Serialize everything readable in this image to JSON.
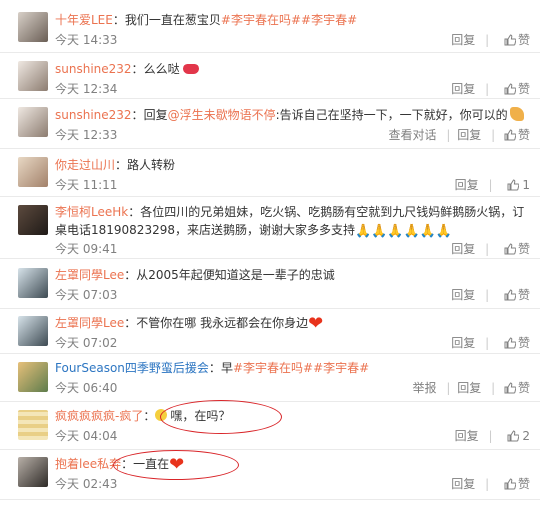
{
  "comments": [
    {
      "user": "十年爱LEE",
      "text": "我们一直在葱宝贝",
      "tags": [
        "#李宇春在吗#",
        "#李宇春#"
      ],
      "time": "今天 14:33",
      "reply_label": "回复",
      "like_label": "赞"
    },
    {
      "user": "sunshine232",
      "text": "么么哒",
      "emoji": "lips-emoji",
      "time": "今天 12:34",
      "reply_label": "回复",
      "like_label": "赞"
    },
    {
      "user": "sunshine232",
      "text_prefix": "回复",
      "mention": "@浮生未歇物语不停",
      "text": ":告诉自己在坚持一下，一下就好，你可以的",
      "emoji": "strong-arm-emoji",
      "time": "今天 12:33",
      "view_dialog_label": "查看对话",
      "reply_label": "回复",
      "like_label": "赞"
    },
    {
      "user": "你走过山川",
      "text": "路人转粉",
      "time": "今天 11:11",
      "reply_label": "回复",
      "like_count": "1"
    },
    {
      "user": "李恒柯LeeHk",
      "text": "各位四川的兄弟姐妹，吃火锅、吃鹅肠有空就到九尺钱妈鲜鹅肠火锅，订桌电话18190823298，来店送鹅肠，谢谢大家多多支持",
      "emoji_text": "🙏🙏🙏🙏🙏🙏",
      "time": "今天 09:41",
      "reply_label": "回复",
      "like_label": "赞"
    },
    {
      "user": "左罩同學Lee",
      "text": "从2005年起便知道这是一辈子的忠诚",
      "time": "今天 07:03",
      "reply_label": "回复",
      "like_label": "赞"
    },
    {
      "user": "左罩同學Lee",
      "text": "不管你在哪 我永远都会在你身边",
      "emoji": "heart-emoji",
      "time": "今天 07:02",
      "reply_label": "回复",
      "like_label": "赞"
    },
    {
      "user": "FourSeason四季野蛮后援会",
      "text": "早",
      "tags": [
        "#李宇春在吗#",
        "#李宇春#"
      ],
      "time": "今天 06:40",
      "report_label": "举报",
      "reply_label": "回复",
      "like_label": "赞"
    },
    {
      "user": "疯疯疯疯疯-疯了",
      "text": "嘿，在吗？",
      "emoji": "crying-face-emoji",
      "time": "今天 04:04",
      "reply_label": "回复",
      "like_count": "2"
    },
    {
      "user": "抱着lee私奔",
      "text": "一直在",
      "emoji": "heart-emoji",
      "time": "今天 02:43",
      "reply_label": "回复",
      "like_label": "赞"
    }
  ],
  "colors": {
    "username": "#eb7350",
    "tag": "#eb7350",
    "meta": "#808080",
    "annotation_oval": "#d9262a"
  }
}
